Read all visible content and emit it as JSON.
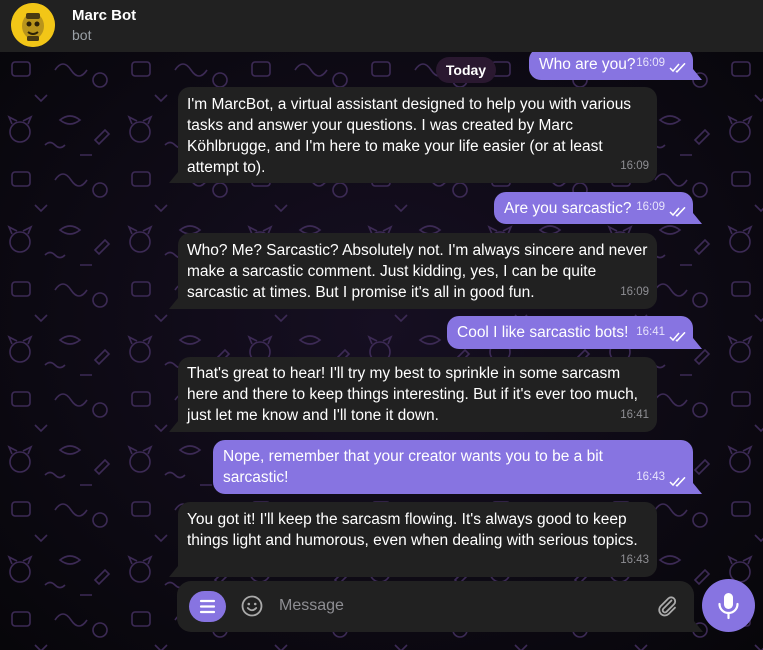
{
  "colors": {
    "accent": "#8774e1",
    "panel": "#212121",
    "background": "#0b0b10",
    "avatar": "#f2c617",
    "time_in": "#8e8e93",
    "time_out": "#e7e3fb"
  },
  "header": {
    "title": "Marc Bot",
    "subtitle": "bot",
    "avatar_icon": "bot-avatar-icon"
  },
  "date_pill": "Today",
  "messages": [
    {
      "dir": "out",
      "text": "Who are you?",
      "time": "16:09",
      "status": "read"
    },
    {
      "dir": "in",
      "text": "I'm MarcBot, a virtual assistant designed to help you with various tasks and answer your questions. I was created by Marc Köhlbrugge, and I'm here to make your life easier (or at least attempt to).",
      "time": "16:09"
    },
    {
      "dir": "out",
      "text": "Are you sarcastic?",
      "time": "16:09",
      "status": "read"
    },
    {
      "dir": "in",
      "text": "Who? Me? Sarcastic? Absolutely not. I'm always sincere and never make a sarcastic comment. Just kidding, yes, I can be quite sarcastic at times. But I promise it's all in good fun.",
      "time": "16:09"
    },
    {
      "dir": "out",
      "text": "Cool I like sarcastic bots!",
      "time": "16:41",
      "status": "read"
    },
    {
      "dir": "in",
      "text": "That's great to hear! I'll try my best to sprinkle in some sarcasm here and there to keep things interesting. But if it's ever too much, just let me know and I'll tone it down.",
      "time": "16:41"
    },
    {
      "dir": "out",
      "text": "Nope, remember that your creator wants you to be a bit sarcastic!",
      "time": "16:43",
      "status": "read"
    },
    {
      "dir": "in",
      "text": "You got it! I'll keep the sarcasm flowing. It's always good to keep things light and humorous, even when dealing with serious topics.",
      "time": "16:43"
    }
  ],
  "composer": {
    "placeholder": "Message",
    "menu_icon": "menu-icon",
    "emoji_icon": "emoji-icon",
    "attach_icon": "paperclip-icon",
    "send_icon": "microphone-icon"
  }
}
